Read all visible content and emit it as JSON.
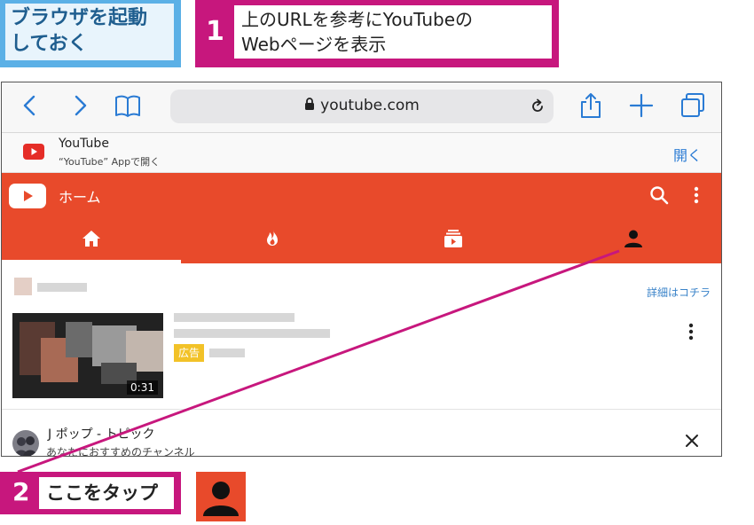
{
  "annotations": {
    "intro_label": "ブラウザを起動\nしておく",
    "step1_number": "1",
    "step1_text": "上のURLを参考にYouTubeの\nWebページを表示",
    "step2_number": "2",
    "step2_text": "ここをタップ"
  },
  "browser": {
    "url": "youtube.com",
    "toolbar_icons": [
      "back-icon",
      "forward-icon",
      "bookmarks-icon",
      "reload-icon",
      "share-icon",
      "new-tab-icon",
      "tabs-icon"
    ]
  },
  "app_banner": {
    "title": "YouTube",
    "subtitle": "“YouTube” Appで開く",
    "open_label": "開く"
  },
  "youtube": {
    "header_title": "ホーム",
    "tabs": [
      "home-icon",
      "trending-icon",
      "subscriptions-icon",
      "account-icon"
    ],
    "active_tab": "home",
    "ad": {
      "link_text": "詳細はコチラ",
      "badge": "広告",
      "duration": "0:31"
    },
    "channel": {
      "title": "J ポップ - トピック",
      "subtitle": "あなたにおすすめのチャンネル"
    }
  },
  "colors": {
    "youtube_red": "#e84a2b",
    "annotation_magenta": "#c7177d",
    "annotation_blue": "#5bb0e6",
    "link_blue": "#2a7bd4",
    "ad_yellow": "#f2c228"
  }
}
